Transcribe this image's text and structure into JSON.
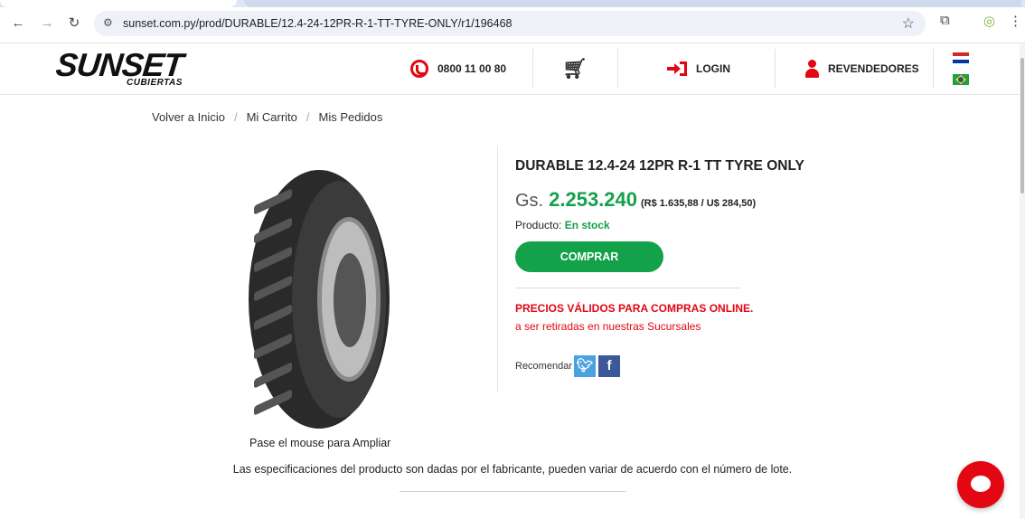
{
  "browser": {
    "url": "sunset.com.py/prod/DURABLE/12.4-24-12PR-R-1-TT-TYRE-ONLY/r1/196468",
    "icons": [
      "back-icon",
      "forward-icon",
      "reload-icon",
      "site-info-icon",
      "star-icon",
      "extensions-icon",
      "profile-icon",
      "menu-icon"
    ]
  },
  "header": {
    "logo_text": "SUNSET",
    "logo_subtext": "CUBIERTAS",
    "phone": "0800 11 00 80",
    "login_label": "LOGIN",
    "resellers_label": "REVENDEDORES"
  },
  "breadcrumb": {
    "items": [
      "Volver a Inicio",
      "Mi Carrito",
      "Mis Pedidos"
    ],
    "separator": "/"
  },
  "product": {
    "title": "DURABLE 12.4-24 12PR R-1 TT TYRE ONLY",
    "currency": "Gs.",
    "price": "2.253.240",
    "alt_prices": "(R$ 1.635,88 / U$ 284,50)",
    "stock_label": "Producto:",
    "stock_value": "En stock",
    "buy_label": "COMPRAR",
    "notice_title": "PRECIOS VÁLIDOS PARA COMPRAS ONLINE.",
    "notice_sub": "a ser retiradas en nuestras Sucursales",
    "share_label": "Recomendar",
    "image_caption": "Pase el mouse para Ampliar"
  },
  "spec_note": "Las especificaciones del producto son dadas por el fabricante, pueden variar de acuerdo con el número de lote.",
  "colors": {
    "brand_red": "#e30613",
    "price_green": "#13a14a"
  }
}
